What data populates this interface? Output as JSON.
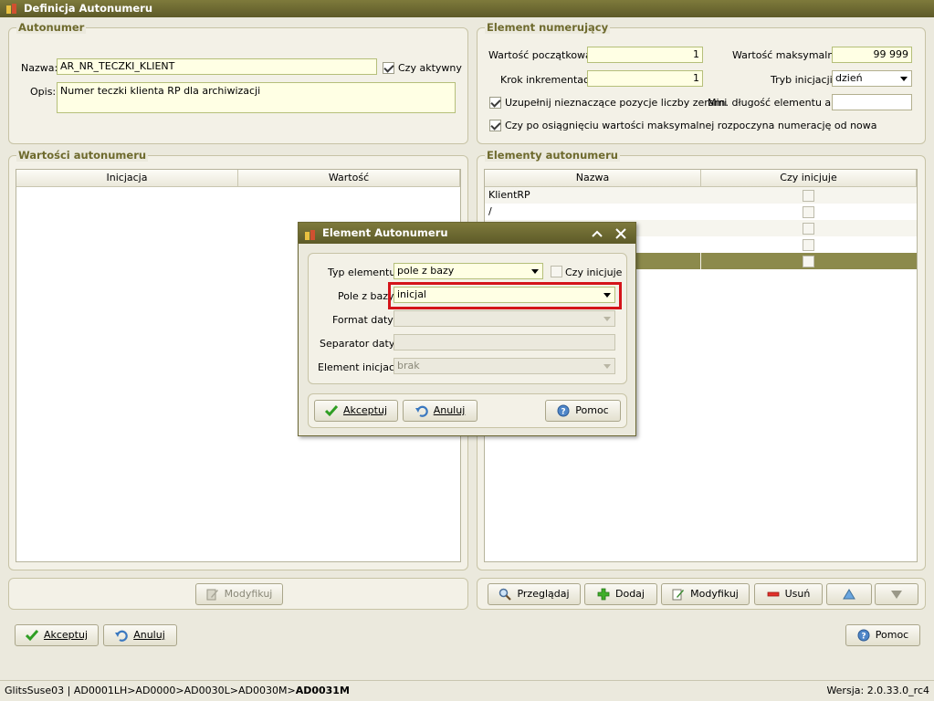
{
  "window": {
    "title": "Definicja Autonumeru"
  },
  "autonumer": {
    "title": "Autonumer",
    "name_label": "Nazwa:",
    "name_value": "AR_NR_TECZKI_KLIENT",
    "active_label": "Czy aktywny",
    "active_checked": true,
    "desc_label": "Opis:",
    "desc_value": "Numer teczki klienta RP dla archiwizacji"
  },
  "element_numerujacy": {
    "title": "Element numerujący",
    "start_label": "Wartość początkowa:",
    "start_value": "1",
    "max_label": "Wartość maksymalna:",
    "max_value": "99 999",
    "step_label": "Krok inkrementacji:",
    "step_value": "1",
    "mode_label": "Tryb inicjacji:",
    "mode_value": "dzień",
    "pad_label": "Uzupełnij nieznaczące pozycje liczby zerami",
    "pad_checked": true,
    "minlen_label": "Min. długość elementu auto",
    "minlen_value": "",
    "restart_label": "Czy po osiągnięciu wartości maksymalnej rozpoczyna numerację od nowa",
    "restart_checked": true
  },
  "wartosci": {
    "title": "Wartości autonumeru",
    "columns": [
      "Inicjacja",
      "Wartość"
    ],
    "modify_label": "Modyfikuj"
  },
  "elementy": {
    "title": "Elementy autonumeru",
    "columns": [
      "Nazwa",
      "Czy inicjuje"
    ],
    "rows": [
      {
        "name": "KlientRP"
      },
      {
        "name": "/"
      },
      {
        "name": ""
      },
      {
        "name": ""
      },
      {
        "name": ""
      }
    ],
    "buttons": {
      "browse": "Przeglądaj",
      "add": "Dodaj",
      "modify": "Modyfikuj",
      "delete": "Usuń"
    }
  },
  "footer": {
    "accept": "Akceptuj",
    "cancel": "Anuluj",
    "help": "Pomoc"
  },
  "dialog": {
    "title": "Element Autonumeru",
    "type_label": "Typ elementu:",
    "type_value": "pole z bazy",
    "initiates_label": "Czy inicjuje",
    "initiates_checked": false,
    "field_label": "Pole z bazy",
    "field_value": "inicjal",
    "dateformat_label": "Format daty:",
    "dateformat_value": "",
    "datesep_label": "Separator daty:",
    "datesep_value": "",
    "initel_label": "Element inicjacji:",
    "initel_value": "brak",
    "accept": "Akceptuj",
    "cancel": "Anuluj",
    "help": "Pomoc"
  },
  "status": {
    "path_prefix": "GlitsSuse03 | AD0001LH>AD0000>AD0030L>AD0030M>",
    "path_current": "AD0031M",
    "version": "Wersja: 2.0.33.0_rc4"
  },
  "colors": {
    "title_bar": "#6e6a30",
    "selected_row": "#8c8a4c",
    "highlight_box": "#d4141a",
    "accent_text": "#6e6a2d"
  }
}
